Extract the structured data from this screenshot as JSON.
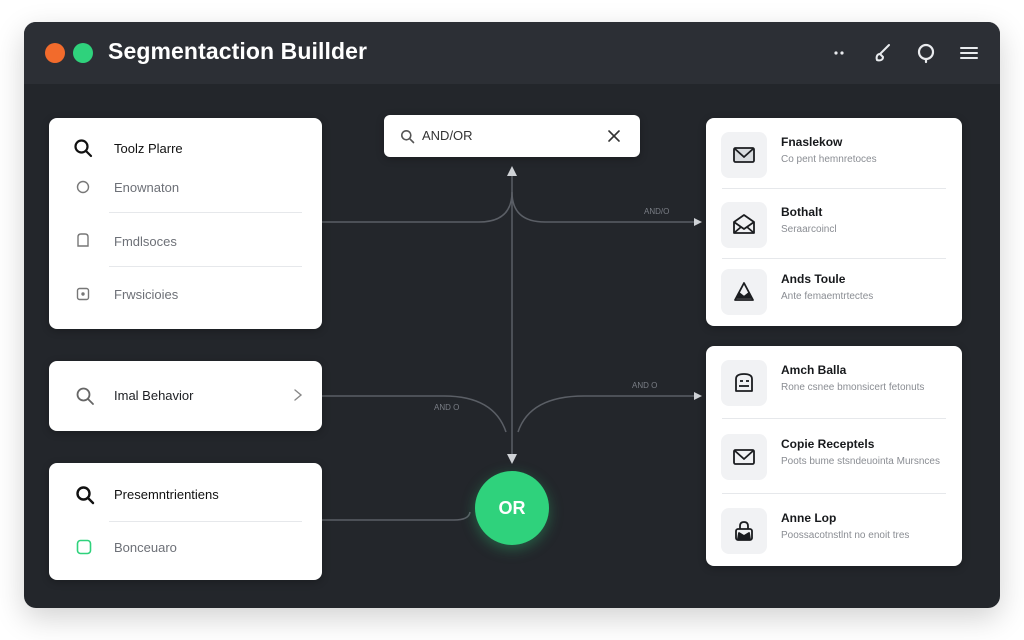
{
  "window": {
    "title": "Segmentaction Buillder"
  },
  "toolbar": {
    "icons": [
      "more-dots-icon",
      "brush-icon",
      "chat-icon",
      "menu-icon"
    ]
  },
  "left_cards": [
    {
      "header": "Toolz Plarre",
      "items": [
        "Enownaton",
        "Fmdlsoces",
        "Frwsicioies"
      ]
    },
    {
      "header": "Imal Behavior"
    },
    {
      "header": "Presemntrientiens",
      "items": [
        "Bonceuaro"
      ]
    }
  ],
  "search": {
    "value": "AND/OR"
  },
  "operator": {
    "label": "OR"
  },
  "wire_labels": [
    "AND/O",
    "AND O",
    "AND O"
  ],
  "right_cards": [
    {
      "items": [
        {
          "title": "Fnaslekow",
          "subtitle": "Co pent hemnretoces",
          "icon": "mail-icon"
        },
        {
          "title": "Bothalt",
          "subtitle": "Seraarcoincl",
          "icon": "mail-open-icon"
        },
        {
          "title": "Ands Toule",
          "subtitle": "Ante femaemtrtectes",
          "icon": "mail-triangle-icon"
        }
      ]
    },
    {
      "items": [
        {
          "title": "Amch Balla",
          "subtitle": "Rone csnee bmonsicert fetonuts",
          "icon": "robot-icon"
        },
        {
          "title": "Copie Receptels",
          "subtitle": "Poots bume stsndeuointa Mursnces",
          "icon": "mail-icon"
        },
        {
          "title": "Anne Lop",
          "subtitle": "Poossacotnstlnt no enoit tres",
          "icon": "lock-icon"
        }
      ]
    }
  ]
}
